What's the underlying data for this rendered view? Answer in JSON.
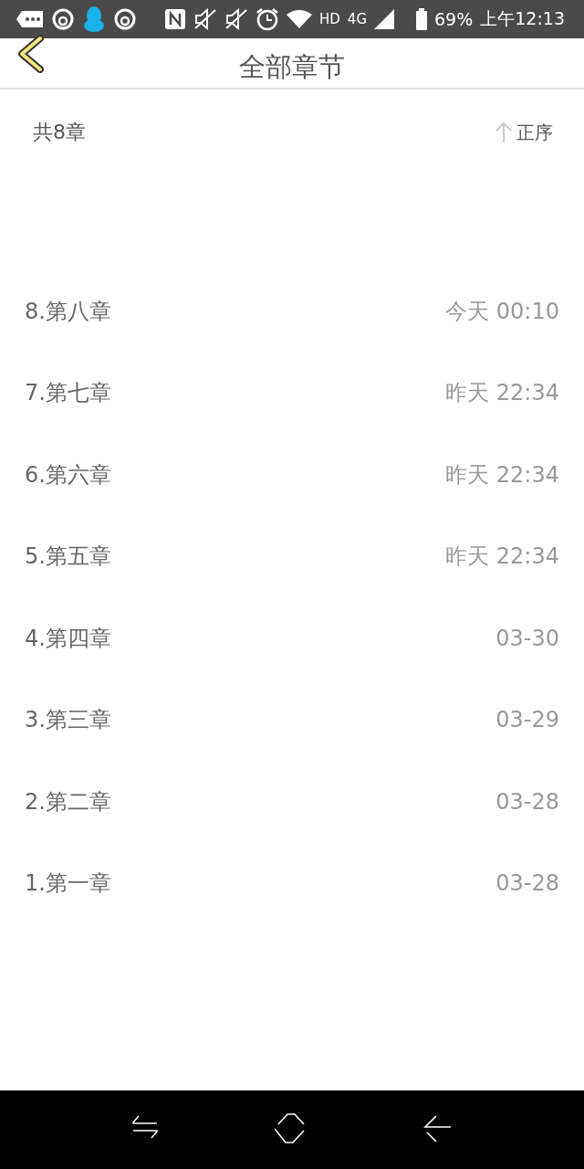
{
  "status_bar": {
    "network": "HD",
    "network_type": "4G",
    "battery": "69%",
    "time": "上午12:13"
  },
  "header": {
    "title": "全部章节"
  },
  "summary": {
    "count": "共8章",
    "sort": "正序"
  },
  "chapters": [
    {
      "title": "8.第八章",
      "date": "今天 00:10"
    },
    {
      "title": "7.第七章",
      "date": "昨天 22:34"
    },
    {
      "title": "6.第六章",
      "date": "昨天 22:34"
    },
    {
      "title": "5.第五章",
      "date": "昨天 22:34"
    },
    {
      "title": "4.第四章",
      "date": "03-30"
    },
    {
      "title": "3.第三章",
      "date": "03-29"
    },
    {
      "title": "2.第二章",
      "date": "03-28"
    },
    {
      "title": "1.第一章",
      "date": "03-28"
    }
  ]
}
